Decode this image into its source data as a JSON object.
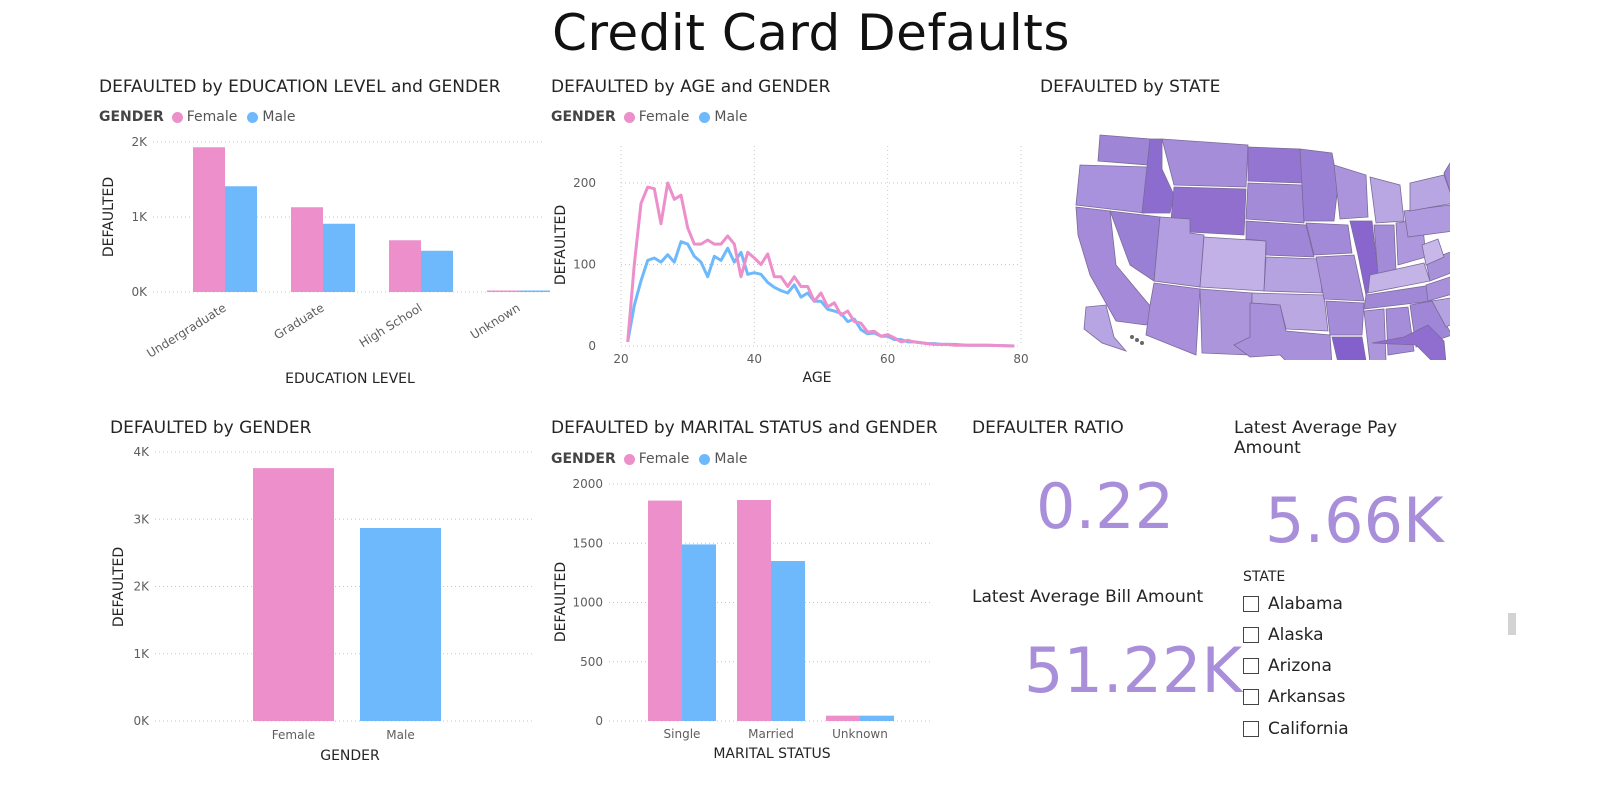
{
  "dashboard_title": "Credit Card Defaults",
  "colors": {
    "female": "#ec8fcb",
    "male": "#6eb9fc",
    "kpi": "#a98ed9",
    "grid": "#c8c8c8"
  },
  "legend": {
    "title": "GENDER",
    "female": "Female",
    "male": "Male"
  },
  "chart_data": [
    {
      "type": "bar",
      "title": "DEFAULTED by EDUCATION LEVEL and GENDER",
      "xlabel": "EDUCATION LEVEL",
      "ylabel": "DEFAULTED",
      "categories": [
        "Undergraduate",
        "Graduate",
        "High School",
        "Unknown"
      ],
      "series": [
        {
          "name": "Female",
          "values": [
            1930,
            1130,
            690,
            15
          ]
        },
        {
          "name": "Male",
          "values": [
            1410,
            910,
            550,
            10
          ]
        }
      ],
      "ylim": [
        0,
        2000
      ],
      "yticks": [
        "0K",
        "1K",
        "2K"
      ],
      "grid": true
    },
    {
      "type": "line",
      "title": "DEFAULTED by AGE and GENDER",
      "xlabel": "AGE",
      "ylabel": "DEFAULTED",
      "xlim": [
        20,
        80
      ],
      "ylim": [
        0,
        200
      ],
      "xticks": [
        "20",
        "40",
        "60",
        "80"
      ],
      "yticks": [
        "0",
        "100",
        "200"
      ],
      "x": [
        21,
        22,
        23,
        24,
        25,
        26,
        27,
        28,
        29,
        30,
        31,
        32,
        33,
        34,
        35,
        36,
        37,
        38,
        39,
        40,
        41,
        42,
        43,
        44,
        45,
        46,
        47,
        48,
        49,
        50,
        51,
        52,
        53,
        54,
        55,
        56,
        57,
        58,
        59,
        60,
        61,
        62,
        63,
        64,
        65,
        66,
        67,
        68,
        69,
        70,
        72,
        74,
        75,
        79
      ],
      "series": [
        {
          "name": "Female",
          "values": [
            5,
            100,
            175,
            195,
            193,
            150,
            200,
            180,
            185,
            145,
            125,
            125,
            130,
            125,
            125,
            135,
            125,
            85,
            115,
            108,
            100,
            113,
            85,
            85,
            73,
            85,
            73,
            73,
            55,
            65,
            48,
            53,
            38,
            43,
            30,
            28,
            17,
            18,
            12,
            14,
            10,
            5,
            7,
            5,
            4,
            3,
            2,
            2,
            2,
            1,
            1,
            1,
            1,
            0
          ]
        },
        {
          "name": "Male",
          "values": [
            5,
            50,
            80,
            105,
            108,
            103,
            112,
            103,
            128,
            125,
            110,
            103,
            85,
            110,
            105,
            120,
            103,
            115,
            88,
            90,
            88,
            78,
            72,
            68,
            65,
            75,
            60,
            65,
            55,
            55,
            45,
            43,
            40,
            30,
            33,
            20,
            15,
            16,
            12,
            12,
            8,
            8,
            5,
            5,
            4,
            3,
            3,
            2,
            2,
            2,
            1,
            1,
            1,
            0
          ]
        }
      ],
      "grid": true
    },
    {
      "type": "bar",
      "title": "DEFAULTED by GENDER",
      "xlabel": "GENDER",
      "ylabel": "DEFAULTED",
      "categories": [
        "Female",
        "Male"
      ],
      "values": [
        3760,
        2870
      ],
      "ylim": [
        0,
        4000
      ],
      "yticks": [
        "0K",
        "1K",
        "2K",
        "3K",
        "4K"
      ],
      "grid": true
    },
    {
      "type": "bar",
      "title": "DEFAULTED by MARITAL STATUS and GENDER",
      "xlabel": "MARITAL STATUS",
      "ylabel": "DEFAULTED",
      "categories": [
        "Single",
        "Married",
        "Unknown"
      ],
      "series": [
        {
          "name": "Female",
          "values": [
            1860,
            1865,
            45
          ]
        },
        {
          "name": "Male",
          "values": [
            1490,
            1350,
            45
          ]
        }
      ],
      "ylim": [
        0,
        2000
      ],
      "yticks": [
        "0",
        "500",
        "1000",
        "1500",
        "2000"
      ],
      "grid": true
    }
  ],
  "map": {
    "title": "DEFAULTED by STATE"
  },
  "kpis": {
    "ratio_title": "DEFAULTER RATIO",
    "ratio_value": "0.22",
    "pay_title": "Latest Average Pay Amount",
    "pay_value": "5.66K",
    "bill_title": "Latest Average Bill Amount",
    "bill_value": "51.22K"
  },
  "slicer": {
    "title": "STATE",
    "items": [
      "Alabama",
      "Alaska",
      "Arizona",
      "Arkansas",
      "California"
    ]
  }
}
